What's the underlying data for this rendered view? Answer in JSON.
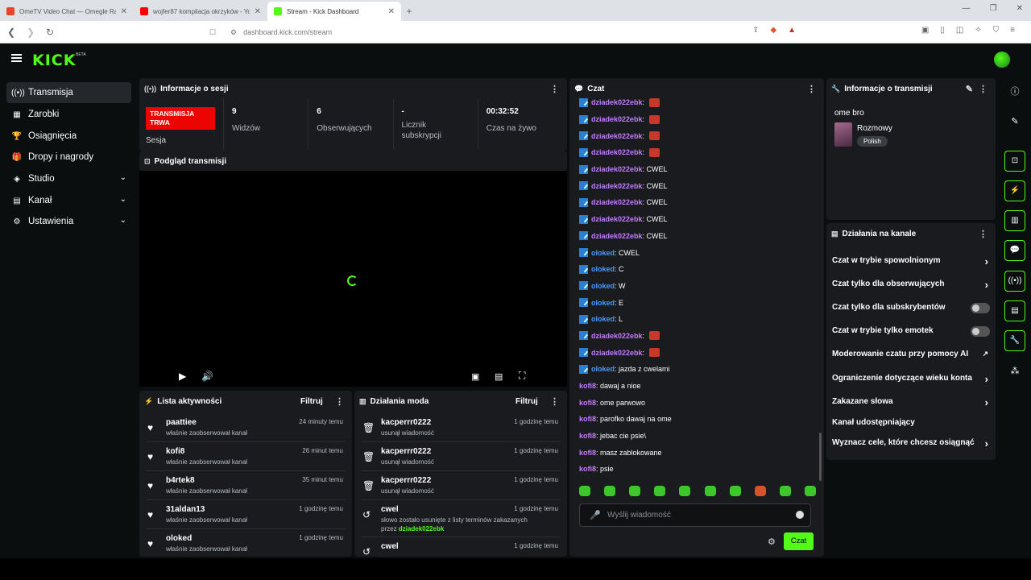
{
  "browser": {
    "tabs": [
      {
        "title": "OmeTV Video Chat — Omegle Ra",
        "fav": "#e8452c"
      },
      {
        "title": "wojfer87 kompilacja okrzyków - YouT",
        "fav": "#ff0000"
      },
      {
        "title": "Stream - Kick Dashboard",
        "fav": "#53fc18"
      }
    ],
    "url": "dashboard.kick.com/stream"
  },
  "brand": {
    "logo": "KICK",
    "beta": "BETA",
    "accent": "#53fc18"
  },
  "sidebar": {
    "items": [
      {
        "label": "Transmisja",
        "icon": "((•))"
      },
      {
        "label": "Zarobki",
        "icon": "▦"
      },
      {
        "label": "Osiągnięcia",
        "icon": "🏆"
      },
      {
        "label": "Dropy i nagrody",
        "icon": "🎁"
      },
      {
        "label": "Studio",
        "icon": "◈"
      },
      {
        "label": "Kanał",
        "icon": "▤"
      },
      {
        "label": "Ustawienia",
        "icon": "⚙"
      }
    ]
  },
  "session": {
    "title": "Informacje o sesji",
    "live_label": "TRANSMISJA TRWA",
    "session_label": "Sesja",
    "stats": [
      {
        "value": "9",
        "label": "Widzów"
      },
      {
        "value": "6",
        "label": "Obserwujących"
      },
      {
        "value": "-",
        "label": "Licznik subskrypcji"
      },
      {
        "value": "00:32:52",
        "label": "Czas na żywo"
      }
    ]
  },
  "preview": {
    "title": "Podgląd transmisji"
  },
  "activity": {
    "title": "Lista aktywności",
    "filter": "Filtruj",
    "rows": [
      {
        "name": "paattiee",
        "desc": "właśnie zaobserwował kanał",
        "time": "24 minuty temu"
      },
      {
        "name": "kofi8",
        "desc": "właśnie zaobserwował kanał",
        "time": "26 minut temu"
      },
      {
        "name": "b4rtek8",
        "desc": "właśnie zaobserwował kanał",
        "time": "35 minut temu"
      },
      {
        "name": "31aldan13",
        "desc": "właśnie zaobserwował kanał",
        "time": "1 godzinę temu"
      },
      {
        "name": "oloked",
        "desc": "właśnie zaobserwował kanał",
        "time": "1 godzinę temu"
      }
    ]
  },
  "modlog": {
    "title": "Działania moda",
    "filter": "Filtruj",
    "rows": [
      {
        "name": "kacperrr0222",
        "desc": "usunął wiadomość",
        "time": "1 godzinę temu"
      },
      {
        "name": "kacperrr0222",
        "desc": "usunął wiadomość",
        "time": "1 godzinę temu"
      },
      {
        "name": "kacperrr0222",
        "desc": "usunął wiadomość",
        "time": "1 godzinę temu"
      },
      {
        "name": "cwel",
        "desc": "słowo zostało usunięte z listy terminów zakazanych",
        "desc2_prefix": "przez",
        "desc2_user": "dziadek022ebk",
        "time": "1 godzinę temu"
      },
      {
        "name": "cwel",
        "desc": "",
        "time": "1 godzinę temu"
      }
    ]
  },
  "chat": {
    "title": "Czat",
    "placeholder": "Wyślij wiadomość",
    "send": "Czat",
    "messages": [
      {
        "user": "dziadek022ebk",
        "text": "",
        "emote": true,
        "badge": true,
        "color": "#c47cff"
      },
      {
        "user": "dziadek022ebk",
        "text": "",
        "emote": true,
        "badge": true,
        "color": "#c47cff"
      },
      {
        "user": "dziadek022ebk",
        "text": "",
        "emote": true,
        "badge": true,
        "color": "#c47cff"
      },
      {
        "user": "dziadek022ebk",
        "text": "",
        "emote": true,
        "badge": true,
        "color": "#c47cff"
      },
      {
        "user": "dziadek022ebk",
        "text": ": CWEL",
        "emote": false,
        "badge": true,
        "color": "#c47cff"
      },
      {
        "user": "dziadek022ebk",
        "text": ": CWEL",
        "emote": false,
        "badge": true,
        "color": "#c47cff"
      },
      {
        "user": "dziadek022ebk",
        "text": ": CWEL",
        "emote": false,
        "badge": true,
        "color": "#c47cff"
      },
      {
        "user": "dziadek022ebk",
        "text": ": CWEL",
        "emote": false,
        "badge": true,
        "color": "#c47cff"
      },
      {
        "user": "dziadek022ebk",
        "text": ": CWEL",
        "emote": false,
        "badge": true,
        "color": "#c47cff"
      },
      {
        "user": "oloked",
        "text": ": CWEL",
        "emote": false,
        "badge": true,
        "color": "#4a9bff"
      },
      {
        "user": "oloked",
        "text": ": C",
        "emote": false,
        "badge": true,
        "color": "#4a9bff"
      },
      {
        "user": "oloked",
        "text": ": W",
        "emote": false,
        "badge": true,
        "color": "#4a9bff"
      },
      {
        "user": "oloked",
        "text": ": E",
        "emote": false,
        "badge": true,
        "color": "#4a9bff"
      },
      {
        "user": "oloked",
        "text": ": L",
        "emote": false,
        "badge": true,
        "color": "#4a9bff"
      },
      {
        "user": "dziadek022ebk",
        "text": "",
        "emote": true,
        "badge": true,
        "color": "#c47cff"
      },
      {
        "user": "dziadek022ebk",
        "text": "",
        "emote": true,
        "badge": true,
        "color": "#c47cff"
      },
      {
        "user": "oloked",
        "text": ": jazda z cwelami",
        "emote": false,
        "badge": true,
        "color": "#4a9bff"
      },
      {
        "user": "kofi8",
        "text": ": dawaj a nioe",
        "emote": false,
        "badge": false,
        "color": "#c47cff"
      },
      {
        "user": "kofi8",
        "text": ": ome parwowo",
        "emote": false,
        "badge": false,
        "color": "#c47cff"
      },
      {
        "user": "kofi8",
        "text": ": parofko dawaj na ome",
        "emote": false,
        "badge": false,
        "color": "#c47cff"
      },
      {
        "user": "kofi8",
        "text": ": jebac cie psie\\",
        "emote": false,
        "badge": false,
        "color": "#c47cff"
      },
      {
        "user": "kofi8",
        "text": ": masz zablokowane",
        "emote": false,
        "badge": false,
        "color": "#c47cff"
      },
      {
        "user": "kofi8",
        "text": ": psie",
        "emote": false,
        "badge": false,
        "color": "#c47cff"
      }
    ]
  },
  "stream_info": {
    "title": "Informacje o transmisji",
    "stream_title": "ome bro",
    "category": "Rozmowy",
    "language": "Polish"
  },
  "channel_actions": {
    "title": "Działania na kanale",
    "items": [
      {
        "label": "Czat w trybie spowolnionym",
        "kind": "arrow"
      },
      {
        "label": "Czat tylko dla obserwujących",
        "kind": "arrow"
      },
      {
        "label": "Czat tylko dla subskrybentów",
        "kind": "toggle"
      },
      {
        "label": "Czat w trybie tylko emotek",
        "kind": "toggle"
      },
      {
        "label": "Moderowanie czatu przy pomocy AI",
        "kind": "external"
      },
      {
        "label": "Ograniczenie dotyczące wieku konta",
        "kind": "arrow"
      },
      {
        "label": "Zakazane słowa",
        "kind": "arrow"
      },
      {
        "label": "Kanał udostępniający",
        "kind": "none"
      },
      {
        "label": "Wyznacz cele, które chcesz osiągnąć",
        "kind": "arrow"
      }
    ]
  }
}
